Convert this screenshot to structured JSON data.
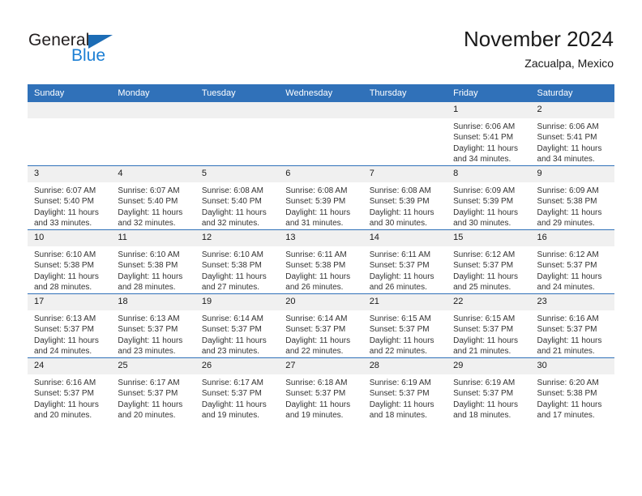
{
  "brand": {
    "word1": "General",
    "word2": "Blue",
    "accent_color": "#1c7fd4",
    "triangle_color": "#1c6cb5"
  },
  "header": {
    "month_title": "November 2024",
    "location": "Zacualpa, Mexico"
  },
  "calendar": {
    "header_color": "#3071b9",
    "daynum_bg": "#f0f0f0",
    "weekdays": [
      "Sunday",
      "Monday",
      "Tuesday",
      "Wednesday",
      "Thursday",
      "Friday",
      "Saturday"
    ],
    "weeks": [
      [
        {
          "day": "",
          "sunrise": "",
          "sunset": "",
          "daylight_line1": "",
          "daylight_line2": ""
        },
        {
          "day": "",
          "sunrise": "",
          "sunset": "",
          "daylight_line1": "",
          "daylight_line2": ""
        },
        {
          "day": "",
          "sunrise": "",
          "sunset": "",
          "daylight_line1": "",
          "daylight_line2": ""
        },
        {
          "day": "",
          "sunrise": "",
          "sunset": "",
          "daylight_line1": "",
          "daylight_line2": ""
        },
        {
          "day": "",
          "sunrise": "",
          "sunset": "",
          "daylight_line1": "",
          "daylight_line2": ""
        },
        {
          "day": "1",
          "sunrise": "Sunrise: 6:06 AM",
          "sunset": "Sunset: 5:41 PM",
          "daylight_line1": "Daylight: 11 hours",
          "daylight_line2": "and 34 minutes."
        },
        {
          "day": "2",
          "sunrise": "Sunrise: 6:06 AM",
          "sunset": "Sunset: 5:41 PM",
          "daylight_line1": "Daylight: 11 hours",
          "daylight_line2": "and 34 minutes."
        }
      ],
      [
        {
          "day": "3",
          "sunrise": "Sunrise: 6:07 AM",
          "sunset": "Sunset: 5:40 PM",
          "daylight_line1": "Daylight: 11 hours",
          "daylight_line2": "and 33 minutes."
        },
        {
          "day": "4",
          "sunrise": "Sunrise: 6:07 AM",
          "sunset": "Sunset: 5:40 PM",
          "daylight_line1": "Daylight: 11 hours",
          "daylight_line2": "and 32 minutes."
        },
        {
          "day": "5",
          "sunrise": "Sunrise: 6:08 AM",
          "sunset": "Sunset: 5:40 PM",
          "daylight_line1": "Daylight: 11 hours",
          "daylight_line2": "and 32 minutes."
        },
        {
          "day": "6",
          "sunrise": "Sunrise: 6:08 AM",
          "sunset": "Sunset: 5:39 PM",
          "daylight_line1": "Daylight: 11 hours",
          "daylight_line2": "and 31 minutes."
        },
        {
          "day": "7",
          "sunrise": "Sunrise: 6:08 AM",
          "sunset": "Sunset: 5:39 PM",
          "daylight_line1": "Daylight: 11 hours",
          "daylight_line2": "and 30 minutes."
        },
        {
          "day": "8",
          "sunrise": "Sunrise: 6:09 AM",
          "sunset": "Sunset: 5:39 PM",
          "daylight_line1": "Daylight: 11 hours",
          "daylight_line2": "and 30 minutes."
        },
        {
          "day": "9",
          "sunrise": "Sunrise: 6:09 AM",
          "sunset": "Sunset: 5:38 PM",
          "daylight_line1": "Daylight: 11 hours",
          "daylight_line2": "and 29 minutes."
        }
      ],
      [
        {
          "day": "10",
          "sunrise": "Sunrise: 6:10 AM",
          "sunset": "Sunset: 5:38 PM",
          "daylight_line1": "Daylight: 11 hours",
          "daylight_line2": "and 28 minutes."
        },
        {
          "day": "11",
          "sunrise": "Sunrise: 6:10 AM",
          "sunset": "Sunset: 5:38 PM",
          "daylight_line1": "Daylight: 11 hours",
          "daylight_line2": "and 28 minutes."
        },
        {
          "day": "12",
          "sunrise": "Sunrise: 6:10 AM",
          "sunset": "Sunset: 5:38 PM",
          "daylight_line1": "Daylight: 11 hours",
          "daylight_line2": "and 27 minutes."
        },
        {
          "day": "13",
          "sunrise": "Sunrise: 6:11 AM",
          "sunset": "Sunset: 5:38 PM",
          "daylight_line1": "Daylight: 11 hours",
          "daylight_line2": "and 26 minutes."
        },
        {
          "day": "14",
          "sunrise": "Sunrise: 6:11 AM",
          "sunset": "Sunset: 5:37 PM",
          "daylight_line1": "Daylight: 11 hours",
          "daylight_line2": "and 26 minutes."
        },
        {
          "day": "15",
          "sunrise": "Sunrise: 6:12 AM",
          "sunset": "Sunset: 5:37 PM",
          "daylight_line1": "Daylight: 11 hours",
          "daylight_line2": "and 25 minutes."
        },
        {
          "day": "16",
          "sunrise": "Sunrise: 6:12 AM",
          "sunset": "Sunset: 5:37 PM",
          "daylight_line1": "Daylight: 11 hours",
          "daylight_line2": "and 24 minutes."
        }
      ],
      [
        {
          "day": "17",
          "sunrise": "Sunrise: 6:13 AM",
          "sunset": "Sunset: 5:37 PM",
          "daylight_line1": "Daylight: 11 hours",
          "daylight_line2": "and 24 minutes."
        },
        {
          "day": "18",
          "sunrise": "Sunrise: 6:13 AM",
          "sunset": "Sunset: 5:37 PM",
          "daylight_line1": "Daylight: 11 hours",
          "daylight_line2": "and 23 minutes."
        },
        {
          "day": "19",
          "sunrise": "Sunrise: 6:14 AM",
          "sunset": "Sunset: 5:37 PM",
          "daylight_line1": "Daylight: 11 hours",
          "daylight_line2": "and 23 minutes."
        },
        {
          "day": "20",
          "sunrise": "Sunrise: 6:14 AM",
          "sunset": "Sunset: 5:37 PM",
          "daylight_line1": "Daylight: 11 hours",
          "daylight_line2": "and 22 minutes."
        },
        {
          "day": "21",
          "sunrise": "Sunrise: 6:15 AM",
          "sunset": "Sunset: 5:37 PM",
          "daylight_line1": "Daylight: 11 hours",
          "daylight_line2": "and 22 minutes."
        },
        {
          "day": "22",
          "sunrise": "Sunrise: 6:15 AM",
          "sunset": "Sunset: 5:37 PM",
          "daylight_line1": "Daylight: 11 hours",
          "daylight_line2": "and 21 minutes."
        },
        {
          "day": "23",
          "sunrise": "Sunrise: 6:16 AM",
          "sunset": "Sunset: 5:37 PM",
          "daylight_line1": "Daylight: 11 hours",
          "daylight_line2": "and 21 minutes."
        }
      ],
      [
        {
          "day": "24",
          "sunrise": "Sunrise: 6:16 AM",
          "sunset": "Sunset: 5:37 PM",
          "daylight_line1": "Daylight: 11 hours",
          "daylight_line2": "and 20 minutes."
        },
        {
          "day": "25",
          "sunrise": "Sunrise: 6:17 AM",
          "sunset": "Sunset: 5:37 PM",
          "daylight_line1": "Daylight: 11 hours",
          "daylight_line2": "and 20 minutes."
        },
        {
          "day": "26",
          "sunrise": "Sunrise: 6:17 AM",
          "sunset": "Sunset: 5:37 PM",
          "daylight_line1": "Daylight: 11 hours",
          "daylight_line2": "and 19 minutes."
        },
        {
          "day": "27",
          "sunrise": "Sunrise: 6:18 AM",
          "sunset": "Sunset: 5:37 PM",
          "daylight_line1": "Daylight: 11 hours",
          "daylight_line2": "and 19 minutes."
        },
        {
          "day": "28",
          "sunrise": "Sunrise: 6:19 AM",
          "sunset": "Sunset: 5:37 PM",
          "daylight_line1": "Daylight: 11 hours",
          "daylight_line2": "and 18 minutes."
        },
        {
          "day": "29",
          "sunrise": "Sunrise: 6:19 AM",
          "sunset": "Sunset: 5:37 PM",
          "daylight_line1": "Daylight: 11 hours",
          "daylight_line2": "and 18 minutes."
        },
        {
          "day": "30",
          "sunrise": "Sunrise: 6:20 AM",
          "sunset": "Sunset: 5:38 PM",
          "daylight_line1": "Daylight: 11 hours",
          "daylight_line2": "and 17 minutes."
        }
      ]
    ]
  }
}
